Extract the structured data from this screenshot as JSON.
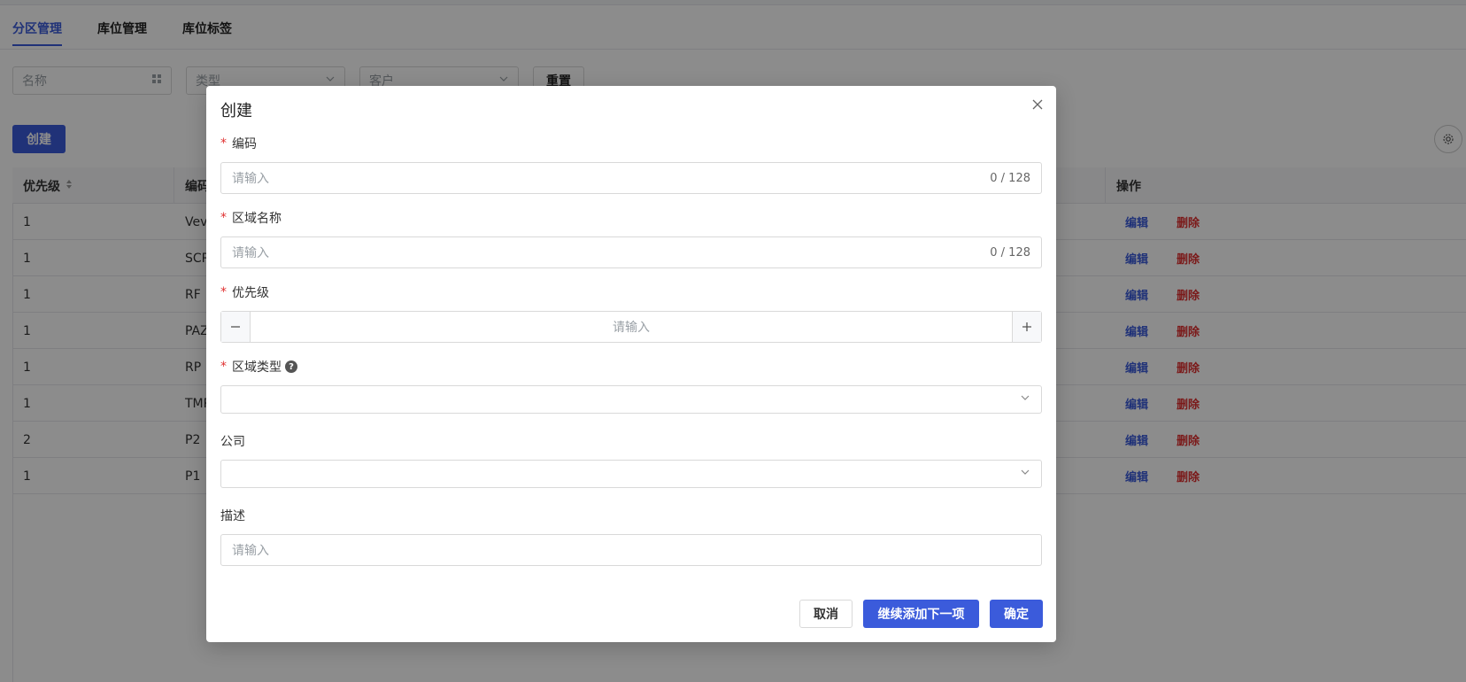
{
  "tabs": [
    {
      "label": "分区管理",
      "active": true
    },
    {
      "label": "库位管理",
      "active": false
    },
    {
      "label": "库位标签",
      "active": false
    }
  ],
  "filters": {
    "name_placeholder": "名称",
    "type_placeholder": "类型",
    "customer_placeholder": "客户",
    "reset_label": "重置"
  },
  "toolbar": {
    "create_label": "创建"
  },
  "table": {
    "columns": {
      "priority": "优先级",
      "code": "编码",
      "actions": "操作"
    },
    "edit_label": "编辑",
    "delete_label": "删除",
    "rows": [
      {
        "priority": "1",
        "code": "Vev"
      },
      {
        "priority": "1",
        "code": "SCR"
      },
      {
        "priority": "1",
        "code": "RF"
      },
      {
        "priority": "1",
        "code": "PAZ"
      },
      {
        "priority": "1",
        "code": "RP"
      },
      {
        "priority": "1",
        "code": "TMP"
      },
      {
        "priority": "2",
        "code": "P2"
      },
      {
        "priority": "1",
        "code": "P1"
      }
    ]
  },
  "modal": {
    "title": "创建",
    "close_symbol": "×",
    "fields": {
      "code": {
        "label": "编码",
        "placeholder": "请输入",
        "counter": "0 / 128",
        "required": true
      },
      "area_name": {
        "label": "区域名称",
        "placeholder": "请输入",
        "counter": "0 / 128",
        "required": true
      },
      "priority": {
        "label": "优先级",
        "placeholder": "请输入",
        "required": true
      },
      "area_type": {
        "label": "区域类型",
        "required": true
      },
      "company": {
        "label": "公司",
        "required": false
      },
      "description": {
        "label": "描述",
        "placeholder": "请输入",
        "required": false
      }
    },
    "buttons": {
      "cancel": "取消",
      "continue_add": "继续添加下一项",
      "confirm": "确定"
    }
  },
  "icons": [
    "grid-icon",
    "chevron-down-icon",
    "settings-icon",
    "sort-icon",
    "close-icon",
    "question-icon",
    "minus-icon",
    "plus-icon"
  ],
  "colors": {
    "primary": "#3b5bdb",
    "danger": "#e03131",
    "required": "#e03131"
  }
}
